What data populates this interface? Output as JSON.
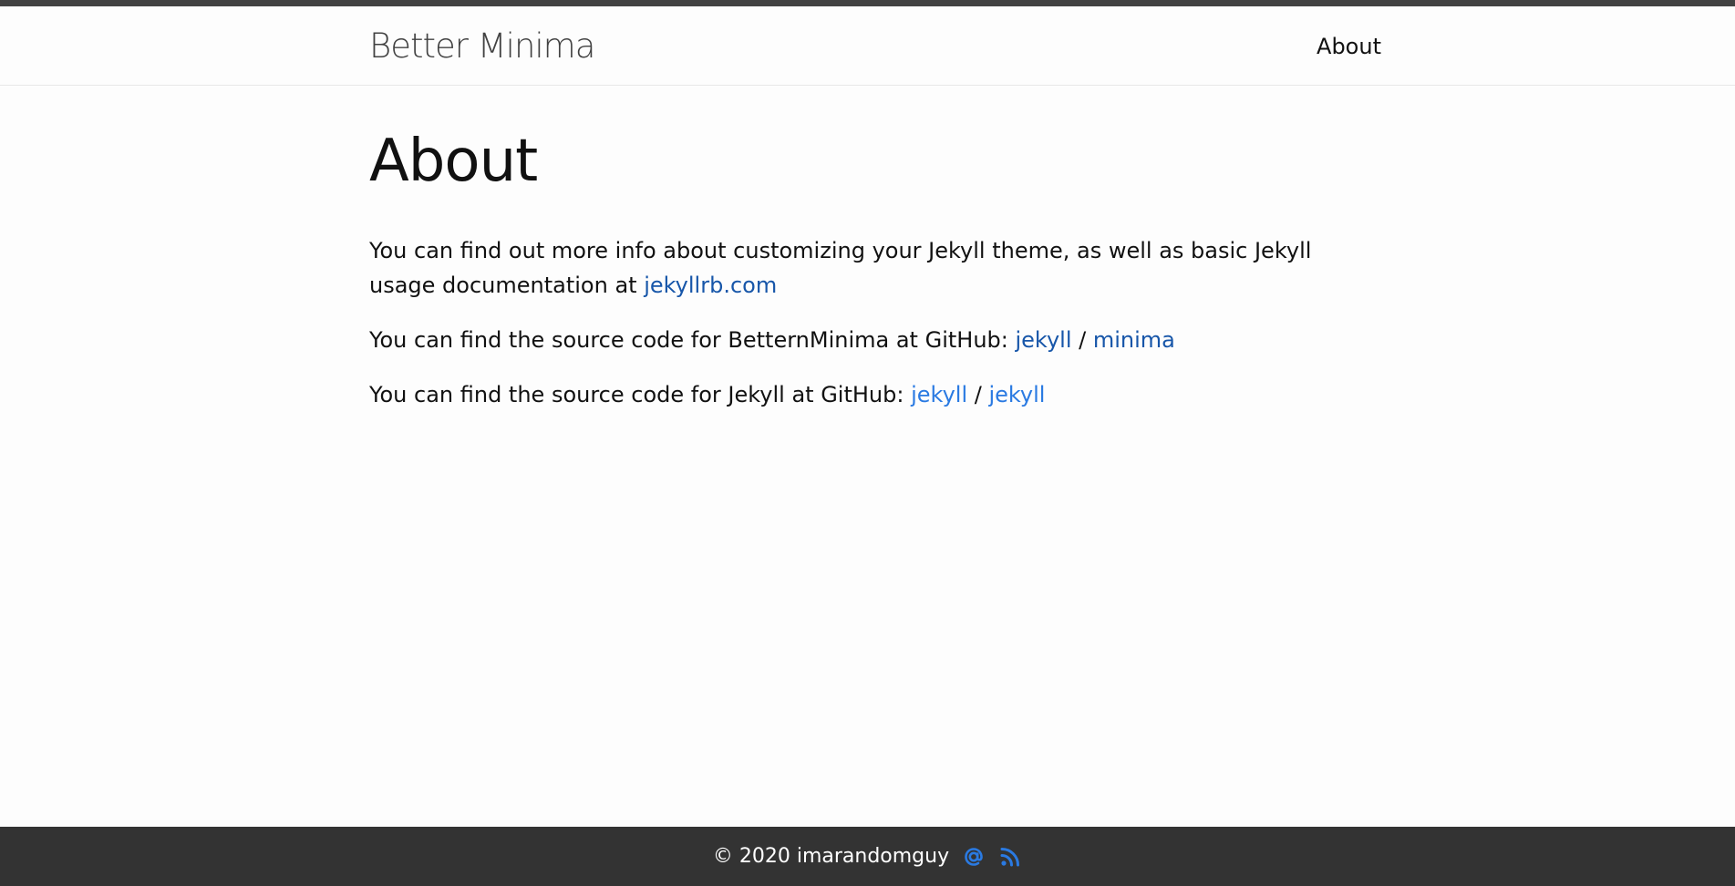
{
  "header": {
    "site_title": "Better Minima",
    "nav": [
      {
        "label": "About"
      }
    ]
  },
  "page": {
    "heading": "About",
    "paragraphs": {
      "p1_text": "You can find out more info about customizing your Jekyll theme, as well as basic Jekyll usage documentation at ",
      "p1_link": "jekyllrb.com",
      "p2_text": "You can find the source code for BetternMinima at GitHub: ",
      "p2_link_user": "jekyll",
      "p2_sep": " / ",
      "p2_link_repo": "minima",
      "p3_text": "You can find the source code for Jekyll at GitHub: ",
      "p3_link_user": "jekyll",
      "p3_sep": " / ",
      "p3_link_repo": "jekyll"
    }
  },
  "footer": {
    "copyright": "© 2020 imarandomguy",
    "icons": [
      "email-icon",
      "rss-icon"
    ]
  },
  "colors": {
    "top_bar": "#424242",
    "link": "#2a7ae2",
    "link_visited": "#1756a9",
    "footer_bg": "#333333",
    "footer_text": "#ffffff"
  }
}
